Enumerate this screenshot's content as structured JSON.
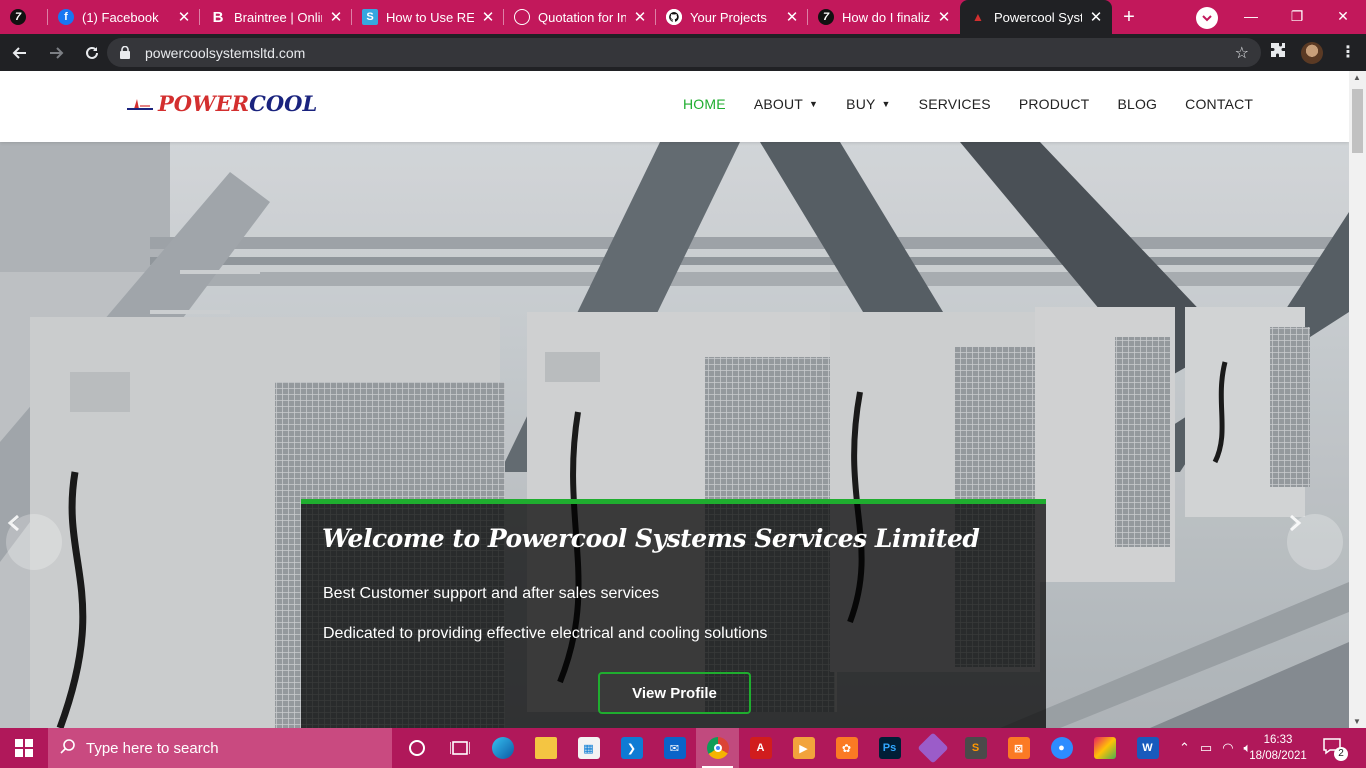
{
  "browser": {
    "tabs": [
      {
        "title": "",
        "favicon": "seven-icon"
      },
      {
        "title": "(1) Facebook",
        "favicon": "facebook-icon"
      },
      {
        "title": "Braintree | Onlin",
        "favicon": "braintree-icon"
      },
      {
        "title": "How to Use RES",
        "favicon": "stackoverflow-icon"
      },
      {
        "title": "Quotation for In",
        "favicon": "quotation-icon"
      },
      {
        "title": "Your Projects",
        "favicon": "github-icon"
      },
      {
        "title": "How do I finalize",
        "favicon": "seven-icon"
      },
      {
        "title": "Powercool Syste",
        "favicon": "powercool-icon",
        "active": true
      }
    ],
    "url": "powercoolsystemsltd.com",
    "accent_color": "#c2185b"
  },
  "site": {
    "logo": {
      "part1": "POWER",
      "part2": "COOL"
    },
    "nav": [
      {
        "label": "HOME",
        "active": true
      },
      {
        "label": "ABOUT",
        "dropdown": true
      },
      {
        "label": "BUY",
        "dropdown": true
      },
      {
        "label": "SERVICES"
      },
      {
        "label": "PRODUCT"
      },
      {
        "label": "BLOG"
      },
      {
        "label": "CONTACT"
      }
    ],
    "hero": {
      "title": "Welcome to Powercool Systems Services Limited",
      "line1": "Best Customer support and after sales services",
      "line2": "Dedicated to providing effective electrical and cooling solutions",
      "button": "View Profile",
      "accent_color": "#1fad2f"
    }
  },
  "taskbar": {
    "search_placeholder": "Type here to search",
    "time": "16:33",
    "date": "18/08/2021",
    "notification_count": "2",
    "apps": [
      "cortana-icon",
      "task-view-icon",
      "edge-icon",
      "file-explorer-icon",
      "store-icon",
      "vscode-icon",
      "mail-icon",
      "chrome-icon",
      "acrobat-icon",
      "media-icon",
      "xampp-icon",
      "photoshop-icon",
      "git-icon",
      "sublime-icon",
      "xampp-control-icon",
      "zoom-icon",
      "paint-icon",
      "word-icon"
    ]
  }
}
